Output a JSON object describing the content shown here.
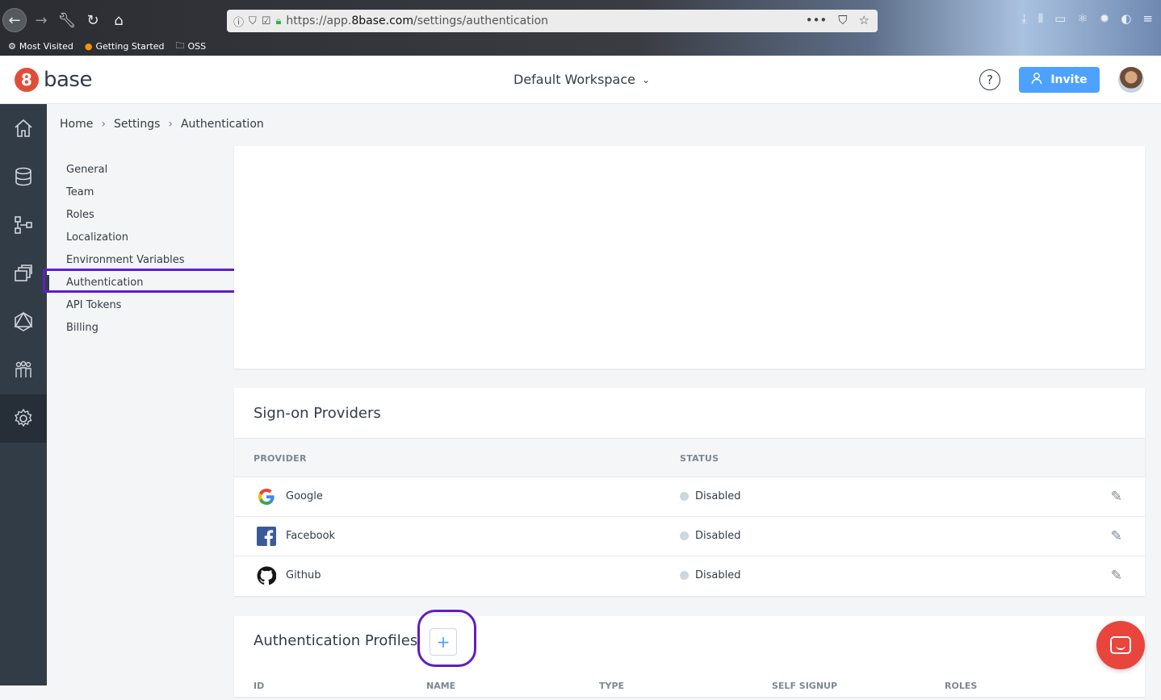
{
  "browser": {
    "url_prefix": "https://app.",
    "url_domain": "8base.com",
    "url_path": "/settings/authentication",
    "bookmarks": [
      "Most Visited",
      "Getting Started",
      "OSS"
    ]
  },
  "header": {
    "logo_mark": "8",
    "logo_text": "base",
    "workspace": "Default Workspace",
    "help": "?",
    "invite_label": "Invite"
  },
  "breadcrumb": [
    "Home",
    "Settings",
    "Authentication"
  ],
  "settings_menu": [
    "General",
    "Team",
    "Roles",
    "Localization",
    "Environment Variables",
    "Authentication",
    "API Tokens",
    "Billing"
  ],
  "active_menu": "Authentication",
  "providers": {
    "title": "Sign-on Providers",
    "columns": [
      "PROVIDER",
      "STATUS"
    ],
    "rows": [
      {
        "name": "Google",
        "status": "Disabled"
      },
      {
        "name": "Facebook",
        "status": "Disabled"
      },
      {
        "name": "Github",
        "status": "Disabled"
      }
    ]
  },
  "profiles": {
    "title": "Authentication Profiles",
    "add": "+",
    "columns": [
      "ID",
      "NAME",
      "TYPE",
      "SELF SIGNUP",
      "ROLES"
    ]
  },
  "colors": {
    "accent": "#4da1ff",
    "highlight": "#5e1ec7",
    "nav": "#323c47",
    "logo": "#e04e3a",
    "chat": "#e8453c"
  }
}
